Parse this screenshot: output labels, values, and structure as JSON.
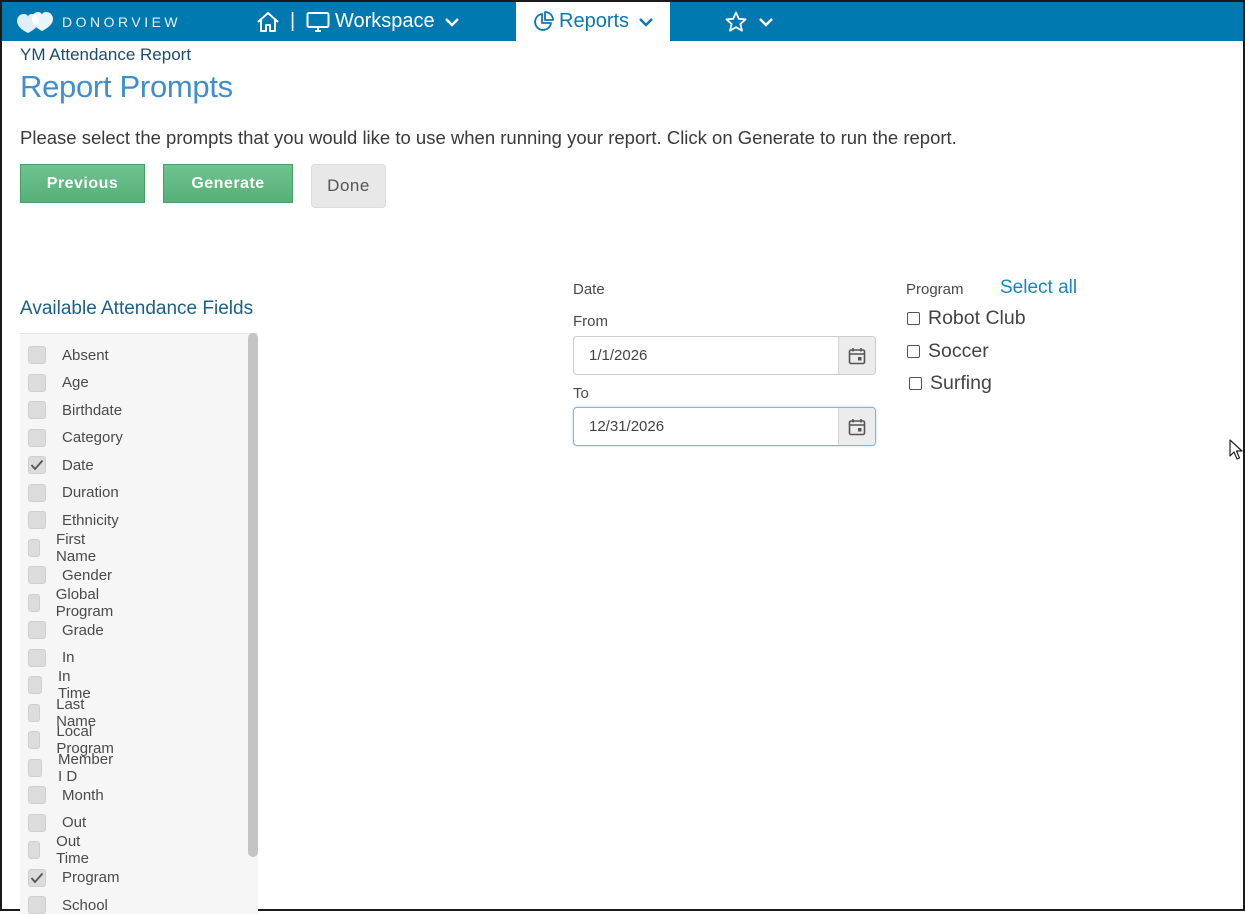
{
  "nav": {
    "brand": "DONORVIEW",
    "workspace_label": "Workspace",
    "reports_label": "Reports",
    "separator": "|"
  },
  "breadcrumb": "YM Attendance Report",
  "page_title": "Report Prompts",
  "instructions": "Please select the prompts that you would like to use when running your report. Click on Generate to run the report.",
  "buttons": {
    "previous": "Previous",
    "generate": "Generate",
    "done": "Done"
  },
  "fields": {
    "heading": "Available Attendance Fields",
    "items": [
      {
        "label": "Absent",
        "checked": false
      },
      {
        "label": "Age",
        "checked": false
      },
      {
        "label": "Birthdate",
        "checked": false
      },
      {
        "label": "Category",
        "checked": false
      },
      {
        "label": "Date",
        "checked": true
      },
      {
        "label": "Duration",
        "checked": false
      },
      {
        "label": "Ethnicity",
        "checked": false
      },
      {
        "label": "First Name",
        "checked": false
      },
      {
        "label": "Gender",
        "checked": false
      },
      {
        "label": "Global Program",
        "checked": false
      },
      {
        "label": "Grade",
        "checked": false
      },
      {
        "label": "In",
        "checked": false
      },
      {
        "label": "In Time",
        "checked": false
      },
      {
        "label": "Last Name",
        "checked": false
      },
      {
        "label": "Local Program",
        "checked": false
      },
      {
        "label": "Member I D",
        "checked": false
      },
      {
        "label": "Month",
        "checked": false
      },
      {
        "label": "Out",
        "checked": false
      },
      {
        "label": "Out Time",
        "checked": false
      },
      {
        "label": "Program",
        "checked": true
      },
      {
        "label": "School",
        "checked": false
      }
    ]
  },
  "date": {
    "label": "Date",
    "from_label": "From",
    "from_value": "1/1/2026",
    "to_label": "To",
    "to_value": "12/31/2026"
  },
  "program": {
    "label": "Program",
    "select_all": "Select all",
    "options": [
      {
        "label": "Robot Club",
        "checked": false
      },
      {
        "label": "Soccer",
        "checked": false
      },
      {
        "label": "Surfing",
        "checked": false
      }
    ]
  },
  "colors": {
    "nav_bg": "#0078b0",
    "title_blue": "#3f8fd0",
    "button_green": "#5db67d",
    "link_blue": "#1787c4"
  }
}
